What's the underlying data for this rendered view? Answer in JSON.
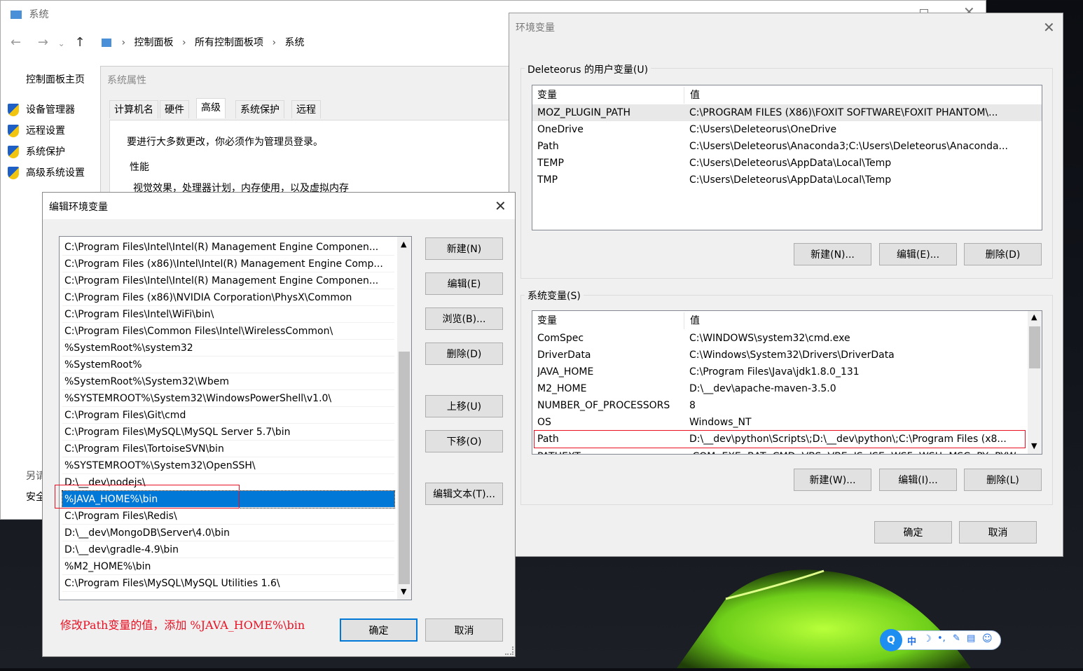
{
  "sys_window": {
    "title": "系统",
    "breadcrumb": [
      "控制面板",
      "所有控制面板项",
      "系统"
    ],
    "left_nav_home": "控制面板主页",
    "left_nav": [
      "设备管理器",
      "远程设置",
      "系统保护",
      "高级系统设置"
    ],
    "see_also_1": "另请",
    "see_also_2": "安全"
  },
  "sys_props": {
    "title": "系统属性",
    "tabs": [
      "计算机名",
      "硬件",
      "高级",
      "系统保护",
      "远程"
    ],
    "admin_note": "要进行大多数更改，你必须作为管理员登录。",
    "perf_group": "性能",
    "perf_desc": "视觉效果，处理器计划，内存使用，以及虚拟内存"
  },
  "env_dialog": {
    "title": "环境变量",
    "user_group": "Deleteorus 的用户变量(U)",
    "col_var": "变量",
    "col_val": "值",
    "user_vars": [
      {
        "name": "MOZ_PLUGIN_PATH",
        "value": "C:\\PROGRAM FILES (X86)\\FOXIT SOFTWARE\\FOXIT PHANTOM\\..."
      },
      {
        "name": "OneDrive",
        "value": "C:\\Users\\Deleteorus\\OneDrive"
      },
      {
        "name": "Path",
        "value": "C:\\Users\\Deleteorus\\Anaconda3;C:\\Users\\Deleteorus\\Anaconda..."
      },
      {
        "name": "TEMP",
        "value": "C:\\Users\\Deleteorus\\AppData\\Local\\Temp"
      },
      {
        "name": "TMP",
        "value": "C:\\Users\\Deleteorus\\AppData\\Local\\Temp"
      }
    ],
    "user_buttons": [
      "新建(N)...",
      "编辑(E)...",
      "删除(D)"
    ],
    "sys_group": "系统变量(S)",
    "sys_vars": [
      {
        "name": "ComSpec",
        "value": "C:\\WINDOWS\\system32\\cmd.exe"
      },
      {
        "name": "DriverData",
        "value": "C:\\Windows\\System32\\Drivers\\DriverData"
      },
      {
        "name": "JAVA_HOME",
        "value": "C:\\Program Files\\Java\\jdk1.8.0_131"
      },
      {
        "name": "M2_HOME",
        "value": "D:\\__dev\\apache-maven-3.5.0"
      },
      {
        "name": "NUMBER_OF_PROCESSORS",
        "value": "8"
      },
      {
        "name": "OS",
        "value": "Windows_NT"
      },
      {
        "name": "Path",
        "value": "D:\\__dev\\python\\Scripts\\;D:\\__dev\\python\\;C:\\Program Files (x8..."
      },
      {
        "name": "PATHEXT",
        "value": ".COM;.EXE;.BAT;.CMD;.VBS;.VBE;.JS;.JSE;.WSF;.WSH;.MSC;.PY;.PYW"
      }
    ],
    "sys_buttons": [
      "新建(W)...",
      "编辑(I)...",
      "删除(L)"
    ],
    "ok": "确定",
    "cancel": "取消"
  },
  "edit_dialog": {
    "title": "编辑环境变量",
    "items": [
      "C:\\Program Files\\Intel\\Intel(R) Management Engine Componen...",
      "C:\\Program Files (x86)\\Intel\\Intel(R) Management Engine Comp...",
      "C:\\Program Files\\Intel\\Intel(R) Management Engine Componen...",
      "C:\\Program Files (x86)\\NVIDIA Corporation\\PhysX\\Common",
      "C:\\Program Files\\Intel\\WiFi\\bin\\",
      "C:\\Program Files\\Common Files\\Intel\\WirelessCommon\\",
      "%SystemRoot%\\system32",
      "%SystemRoot%",
      "%SystemRoot%\\System32\\Wbem",
      "%SYSTEMROOT%\\System32\\WindowsPowerShell\\v1.0\\",
      "C:\\Program Files\\Git\\cmd",
      "C:\\Program Files\\MySQL\\MySQL Server 5.7\\bin",
      "C:\\Program Files\\TortoiseSVN\\bin",
      "%SYSTEMROOT%\\System32\\OpenSSH\\",
      "D:\\__dev\\nodejs\\",
      "%JAVA_HOME%\\bin",
      "C:\\Program Files\\Redis\\",
      "D:\\__dev\\MongoDB\\Server\\4.0\\bin",
      "D:\\__dev\\gradle-4.9\\bin",
      "%M2_HOME%\\bin",
      "C:\\Program Files\\MySQL\\MySQL Utilities 1.6\\"
    ],
    "selected_index": 15,
    "buttons": [
      "新建(N)",
      "编辑(E)",
      "浏览(B)...",
      "删除(D)",
      "上移(U)",
      "下移(O)",
      "编辑文本(T)..."
    ],
    "annotation": "修改Path变量的值，添加 %JAVA_HOME%\\bin",
    "ok": "确定",
    "cancel": "取消"
  },
  "ime_bar": {
    "lang": "中",
    "icons": [
      "moon-icon",
      "punct-icon",
      "wrench-icon",
      "clipboard-icon",
      "smiley-icon"
    ]
  },
  "colors": {
    "accent": "#0078d7",
    "highlight_box": "#e81123",
    "annotation": "#e81123"
  }
}
